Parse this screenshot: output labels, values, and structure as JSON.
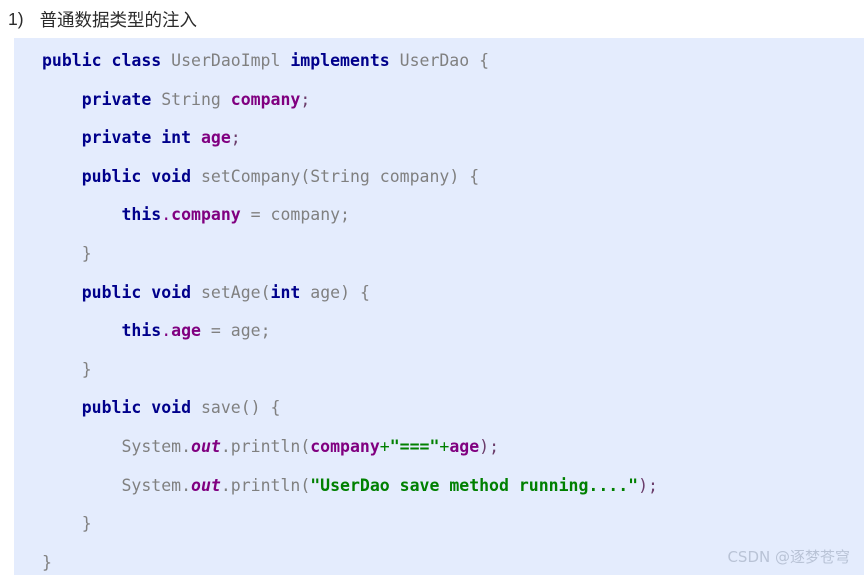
{
  "heading": {
    "marker": "1)",
    "text": "普通数据类型的注入"
  },
  "code_block": {
    "language": "java",
    "background_color": "#e4ecfd",
    "token_colors": {
      "keyword": "#00008b",
      "plain": "#808080",
      "field": "#800080",
      "string": "#008000",
      "operator": "#008000",
      "punctuation": "#6b3d6b"
    },
    "lines": [
      {
        "indent": 0,
        "tokens": [
          {
            "t": "public",
            "c": "kw"
          },
          {
            "t": " ",
            "c": "pln"
          },
          {
            "t": "class",
            "c": "kw"
          },
          {
            "t": " UserDaoImpl ",
            "c": "pln"
          },
          {
            "t": "implements",
            "c": "kw"
          },
          {
            "t": " UserDao {",
            "c": "pln"
          }
        ]
      },
      {
        "indent": 1,
        "tokens": [
          {
            "t": "private",
            "c": "kw"
          },
          {
            "t": " String ",
            "c": "pln"
          },
          {
            "t": "company",
            "c": "fld"
          },
          {
            "t": ";",
            "c": "pct"
          }
        ]
      },
      {
        "indent": 1,
        "tokens": [
          {
            "t": "private",
            "c": "kw"
          },
          {
            "t": " ",
            "c": "pln"
          },
          {
            "t": "int",
            "c": "kw"
          },
          {
            "t": " ",
            "c": "pln"
          },
          {
            "t": "age",
            "c": "fld"
          },
          {
            "t": ";",
            "c": "pct"
          }
        ]
      },
      {
        "indent": 1,
        "tokens": [
          {
            "t": "public",
            "c": "kw"
          },
          {
            "t": " ",
            "c": "pln"
          },
          {
            "t": "void",
            "c": "kw"
          },
          {
            "t": " setCompany(String company) {",
            "c": "pln"
          }
        ]
      },
      {
        "indent": 2,
        "tokens": [
          {
            "t": "this",
            "c": "kw"
          },
          {
            "t": ".",
            "c": "dot"
          },
          {
            "t": "company",
            "c": "fld"
          },
          {
            "t": " = company;",
            "c": "pln"
          }
        ]
      },
      {
        "indent": 1,
        "tokens": [
          {
            "t": "}",
            "c": "pln"
          }
        ]
      },
      {
        "indent": 1,
        "tokens": [
          {
            "t": "public",
            "c": "kw"
          },
          {
            "t": " ",
            "c": "pln"
          },
          {
            "t": "void",
            "c": "kw"
          },
          {
            "t": " setAge(",
            "c": "pln"
          },
          {
            "t": "int",
            "c": "kw"
          },
          {
            "t": " age) {",
            "c": "pln"
          }
        ]
      },
      {
        "indent": 2,
        "tokens": [
          {
            "t": "this",
            "c": "kw"
          },
          {
            "t": ".",
            "c": "dot"
          },
          {
            "t": "age",
            "c": "fld"
          },
          {
            "t": " = age;",
            "c": "pln"
          }
        ]
      },
      {
        "indent": 1,
        "tokens": [
          {
            "t": "}",
            "c": "pln"
          }
        ]
      },
      {
        "indent": 1,
        "tokens": [
          {
            "t": "public",
            "c": "kw"
          },
          {
            "t": " ",
            "c": "pln"
          },
          {
            "t": "void",
            "c": "kw"
          },
          {
            "t": " save() {",
            "c": "pln"
          }
        ]
      },
      {
        "indent": 2,
        "tokens": [
          {
            "t": "System.",
            "c": "pln"
          },
          {
            "t": "out",
            "c": "fldi"
          },
          {
            "t": ".println(",
            "c": "pln"
          },
          {
            "t": "company",
            "c": "fld"
          },
          {
            "t": "+",
            "c": "op"
          },
          {
            "t": "\"===\"",
            "c": "str"
          },
          {
            "t": "+",
            "c": "op"
          },
          {
            "t": "age",
            "c": "fld"
          },
          {
            "t": ");",
            "c": "pct"
          }
        ]
      },
      {
        "indent": 2,
        "tokens": [
          {
            "t": "System.",
            "c": "pln"
          },
          {
            "t": "out",
            "c": "fldi"
          },
          {
            "t": ".println(",
            "c": "pln"
          },
          {
            "t": "\"UserDao save method running....\"",
            "c": "str"
          },
          {
            "t": ");",
            "c": "pct"
          }
        ]
      },
      {
        "indent": 1,
        "tokens": [
          {
            "t": "}",
            "c": "pln"
          }
        ]
      },
      {
        "indent": 0,
        "tokens": [
          {
            "t": "}",
            "c": "pln"
          }
        ]
      }
    ]
  },
  "watermark": {
    "text": "CSDN @逐梦苍穹"
  }
}
